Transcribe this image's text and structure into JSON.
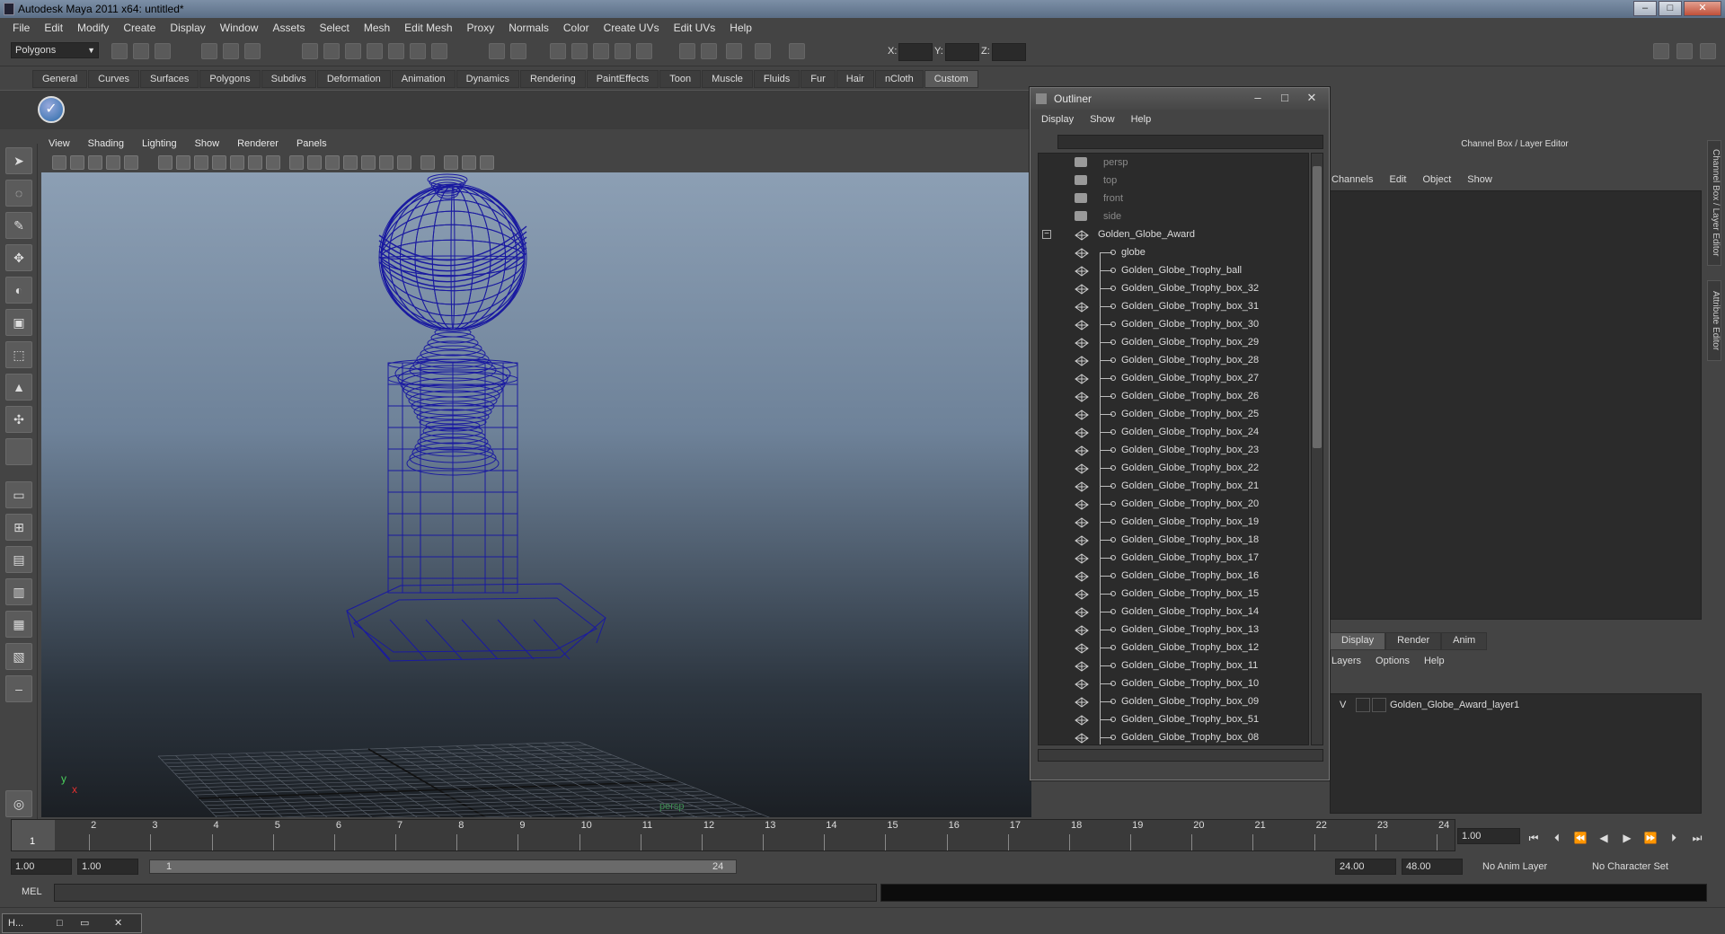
{
  "window": {
    "title": "Autodesk Maya 2011 x64: untitled*",
    "min": "–",
    "max": "□",
    "close": "✕"
  },
  "menubar": [
    "File",
    "Edit",
    "Modify",
    "Create",
    "Display",
    "Window",
    "Assets",
    "Select",
    "Mesh",
    "Edit Mesh",
    "Proxy",
    "Normals",
    "Color",
    "Create UVs",
    "Edit UVs",
    "Help"
  ],
  "statusline": {
    "mode": "Polygons",
    "x_label": "X:",
    "y_label": "Y:",
    "z_label": "Z:"
  },
  "shelf_tabs": [
    "General",
    "Curves",
    "Surfaces",
    "Polygons",
    "Subdivs",
    "Deformation",
    "Animation",
    "Dynamics",
    "Rendering",
    "PaintEffects",
    "Toon",
    "Muscle",
    "Fluids",
    "Fur",
    "Hair",
    "nCloth",
    "Custom"
  ],
  "shelf_active": "Custom",
  "viewport": {
    "menus": [
      "View",
      "Shading",
      "Lighting",
      "Show",
      "Renderer",
      "Panels"
    ],
    "camera_label": "persp",
    "axis_y": "y",
    "axis_x": "x",
    "wire_color": "#1a1aa0"
  },
  "outliner": {
    "title": "Outliner",
    "menus": [
      "Display",
      "Show",
      "Help"
    ],
    "cameras": [
      "persp",
      "top",
      "front",
      "side"
    ],
    "group": "Golden_Globe_Award",
    "children": [
      "globe",
      "Golden_Globe_Trophy_ball",
      "Golden_Globe_Trophy_box_32",
      "Golden_Globe_Trophy_box_31",
      "Golden_Globe_Trophy_box_30",
      "Golden_Globe_Trophy_box_29",
      "Golden_Globe_Trophy_box_28",
      "Golden_Globe_Trophy_box_27",
      "Golden_Globe_Trophy_box_26",
      "Golden_Globe_Trophy_box_25",
      "Golden_Globe_Trophy_box_24",
      "Golden_Globe_Trophy_box_23",
      "Golden_Globe_Trophy_box_22",
      "Golden_Globe_Trophy_box_21",
      "Golden_Globe_Trophy_box_20",
      "Golden_Globe_Trophy_box_19",
      "Golden_Globe_Trophy_box_18",
      "Golden_Globe_Trophy_box_17",
      "Golden_Globe_Trophy_box_16",
      "Golden_Globe_Trophy_box_15",
      "Golden_Globe_Trophy_box_14",
      "Golden_Globe_Trophy_box_13",
      "Golden_Globe_Trophy_box_12",
      "Golden_Globe_Trophy_box_11",
      "Golden_Globe_Trophy_box_10",
      "Golden_Globe_Trophy_box_09",
      "Golden_Globe_Trophy_box_51",
      "Golden_Globe_Trophy_box_08"
    ]
  },
  "channel_box": {
    "header": "Channel Box / Layer Editor",
    "menus": [
      "Channels",
      "Edit",
      "Object",
      "Show"
    ]
  },
  "layer_editor": {
    "tabs": [
      "Display",
      "Render",
      "Anim"
    ],
    "menus": [
      "Layers",
      "Options",
      "Help"
    ],
    "layer": {
      "visible": "V",
      "name": "Golden_Globe_Award_layer1"
    }
  },
  "side_tabs": [
    "Channel Box / Layer Editor",
    "Attribute Editor"
  ],
  "timeline": {
    "ticks": [
      "1",
      "2",
      "3",
      "4",
      "5",
      "6",
      "7",
      "8",
      "9",
      "10",
      "11",
      "12",
      "13",
      "14",
      "15",
      "16",
      "17",
      "18",
      "19",
      "20",
      "21",
      "22",
      "23",
      "24"
    ],
    "current": "1",
    "current_time": "1.00"
  },
  "range": {
    "start_time": "1.00",
    "playback_start": "1.00",
    "slider_start": "1",
    "slider_end": "24",
    "playback_end": "24.00",
    "end_time": "48.00",
    "anim_layer": "No Anim Layer",
    "char_set": "No Character Set"
  },
  "mel": {
    "label": "MEL"
  },
  "helpline": {
    "window_label": "H..."
  }
}
